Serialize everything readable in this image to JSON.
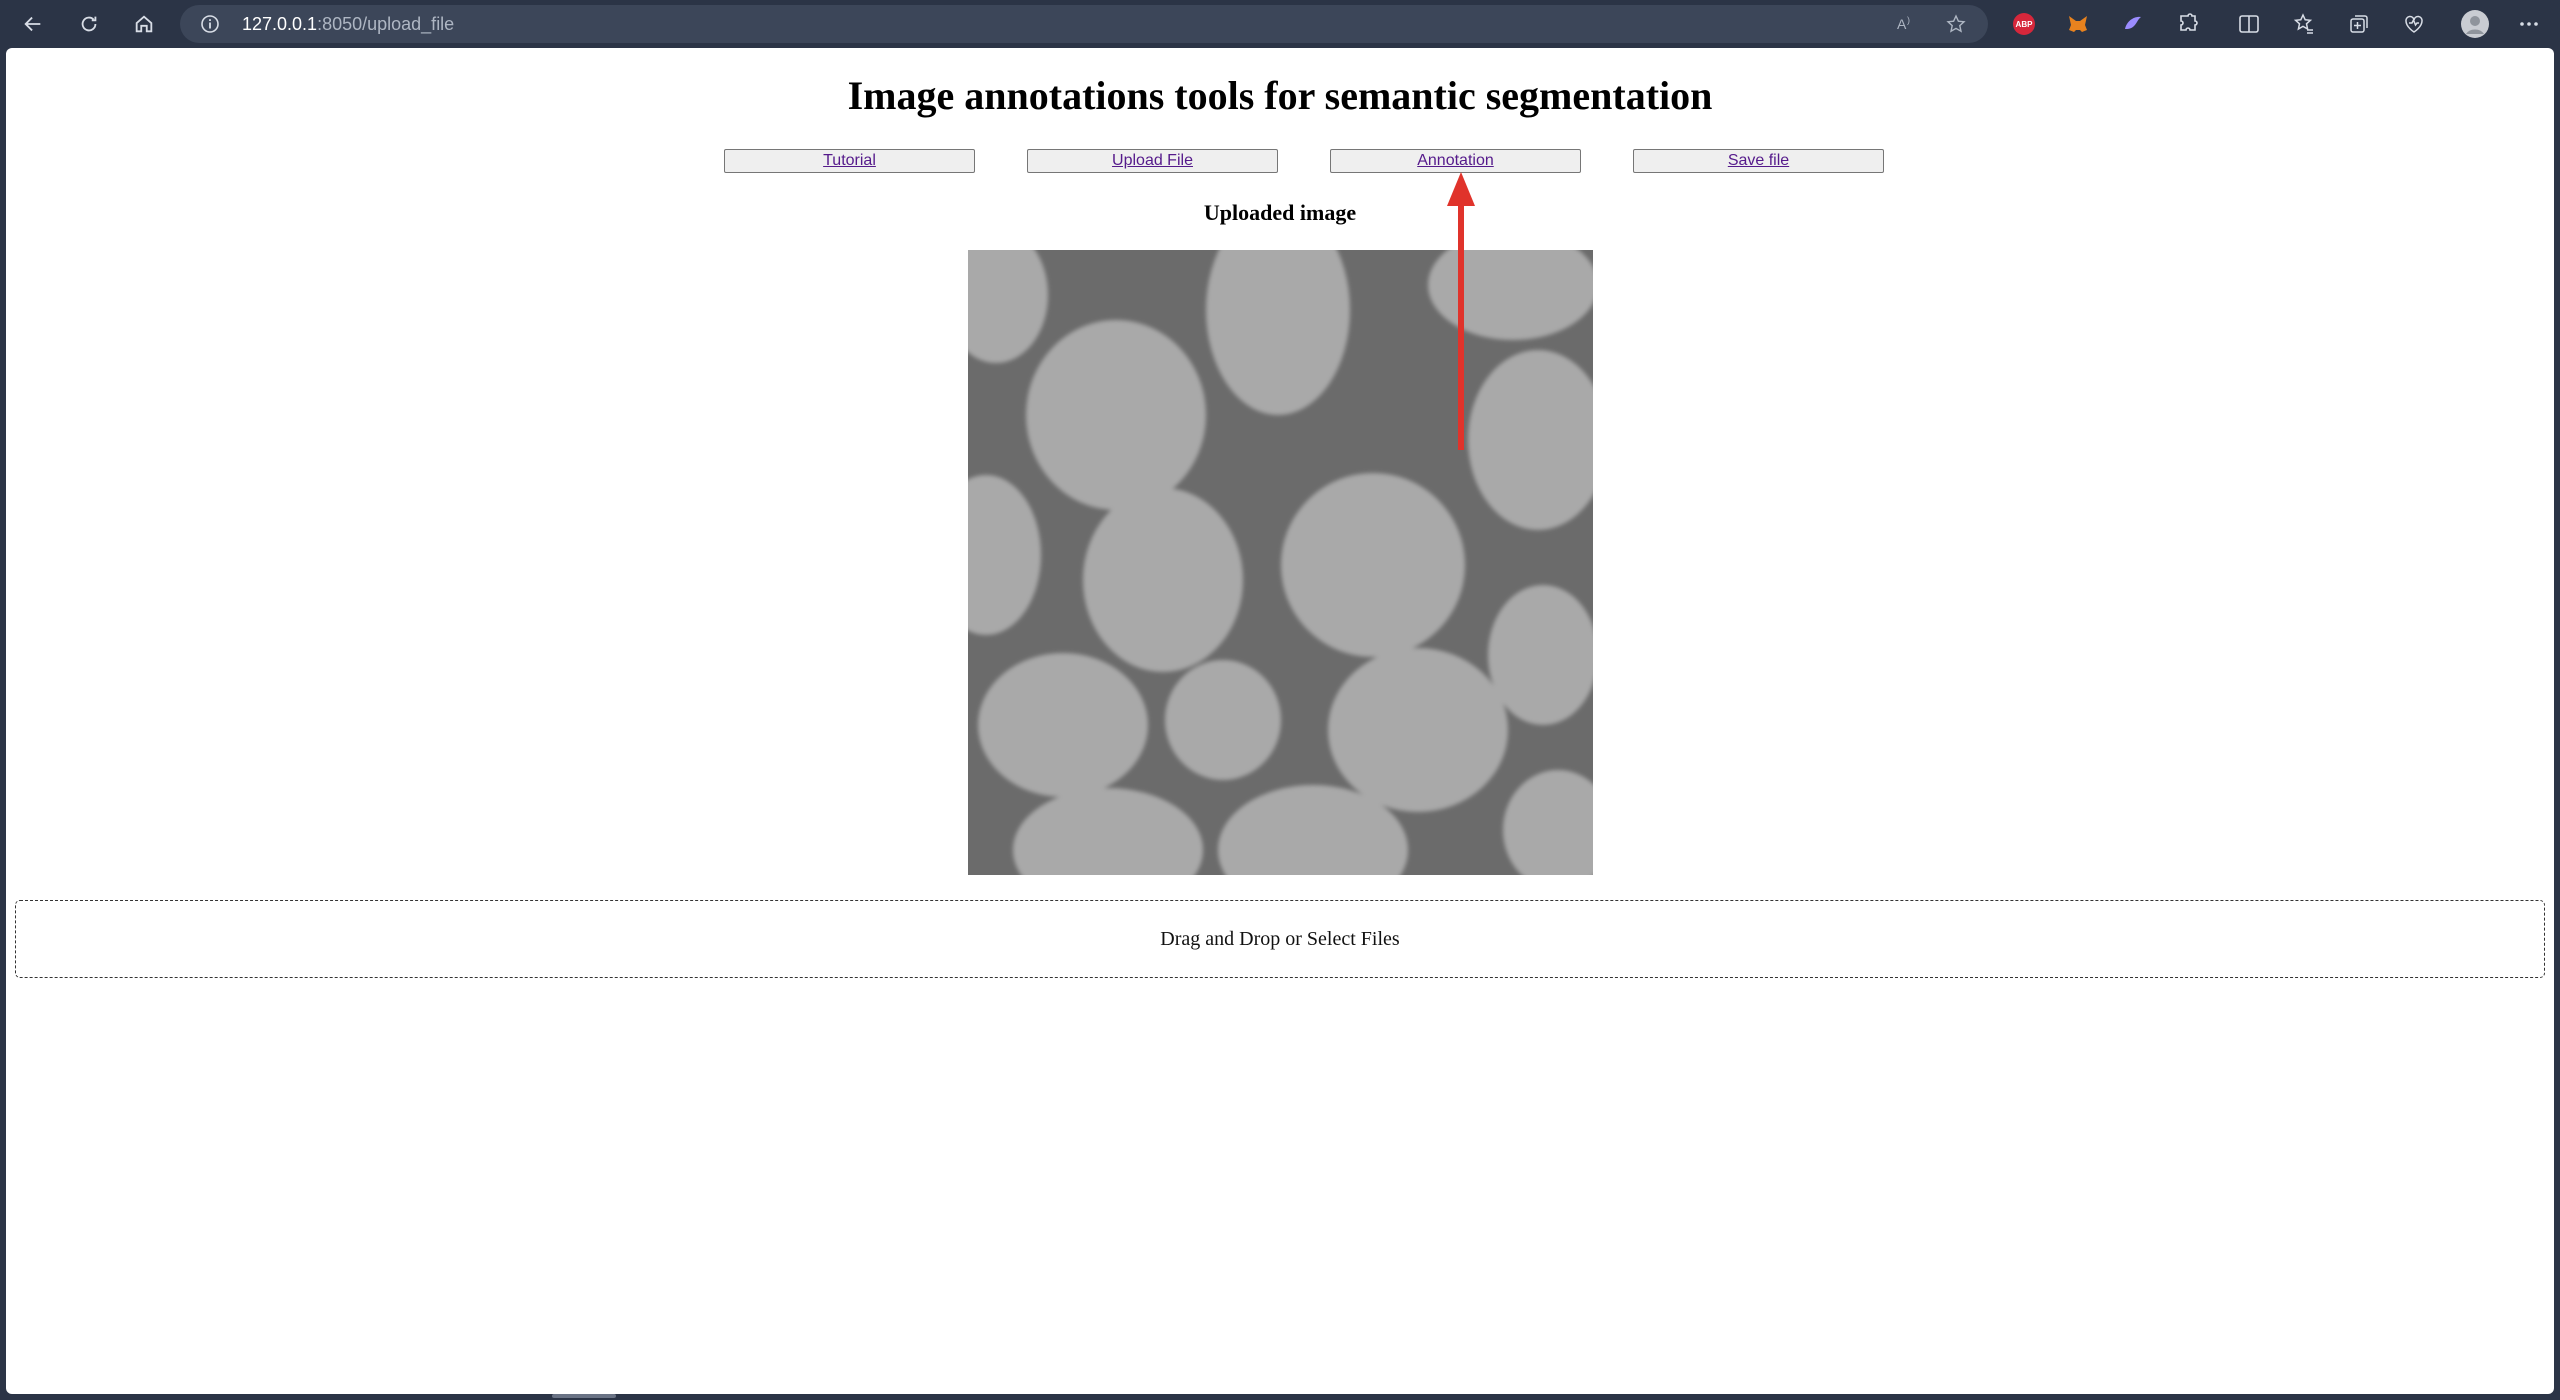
{
  "browser": {
    "address_host": "127.0.0.1",
    "address_path": ":8050/upload_file",
    "icons": [
      "back-icon",
      "refresh-icon",
      "home-icon",
      "site-info-icon",
      "read-aloud-icon",
      "favorite-star-icon",
      "adblock-icon",
      "metamask-icon",
      "extension-icon",
      "puzzle-extensions-icon",
      "split-screen-icon",
      "favorites-icon",
      "collections-icon",
      "performance-icon",
      "profile-avatar",
      "more-menu-icon"
    ],
    "adblock_badge": "ABP"
  },
  "page": {
    "title": "Image annotations tools for semantic segmentation",
    "nav": {
      "tutorial": "Tutorial",
      "upload_file": "Upload File",
      "annotation": "Annotation",
      "save_file": "Save file"
    },
    "subtitle": "Uploaded image",
    "dropzone_text": "Drag and Drop or Select Files"
  },
  "colors": {
    "chrome_bg": "#2b3446",
    "address_bg": "#3c4659",
    "link": "#551a8b",
    "arrow": "#e0332b",
    "image_bg": "#6b6b6b",
    "image_blob": "#a9a9a9"
  }
}
